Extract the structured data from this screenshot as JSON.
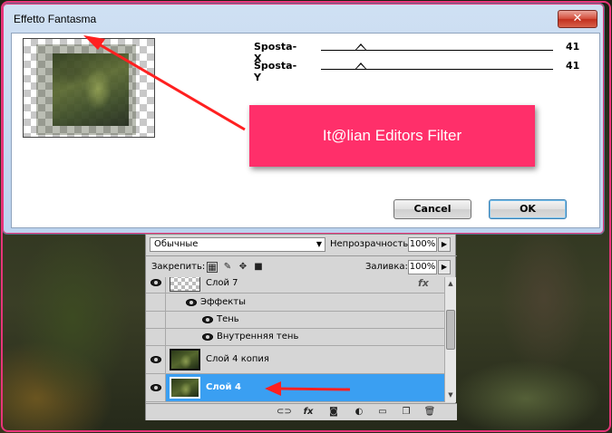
{
  "dialog": {
    "title": "Effetto Fantasma",
    "close_label": "✕",
    "sliders": [
      {
        "label": "Sposta-X",
        "value": "41"
      },
      {
        "label": "Sposta-Y",
        "value": "41"
      }
    ],
    "banner_text": "It@lian Editors Filter",
    "cancel_label": "Cancel",
    "ok_label": "OK"
  },
  "layers_panel": {
    "blend_mode": "Обычные",
    "opacity_label": "Непрозрачность:",
    "opacity_value": "100%",
    "lock_label": "Закрепить:",
    "fill_label": "Заливка:",
    "fill_value": "100%",
    "lock_icons": [
      "transparency-lock-icon",
      "brush-icon",
      "move-icon",
      "lock-icon"
    ],
    "layers": [
      {
        "name": "Слой 7",
        "fx": "fx",
        "effects_label": "Эффекты",
        "effects": [
          "Тень",
          "Внутренняя тень"
        ]
      },
      {
        "name": "Слой 4 копия"
      },
      {
        "name": "Слой 4",
        "selected": true
      }
    ],
    "bottom_icons": [
      "link-icon",
      "fx-icon",
      "mask-icon",
      "adjustment-icon",
      "folder-icon",
      "new-layer-icon",
      "trash-icon"
    ]
  },
  "colors": {
    "accent_pink": "#ff2f6a",
    "frame_pink": "#e8357a",
    "arrow_red": "#ff2020",
    "selected_layer": "#3a9ff2"
  }
}
